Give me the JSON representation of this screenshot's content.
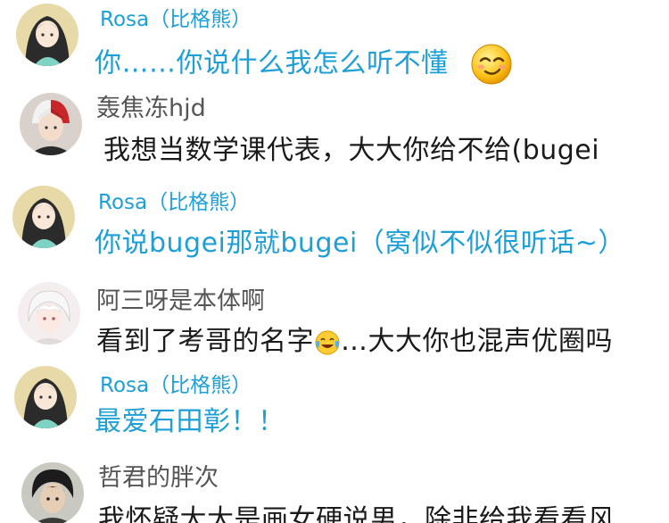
{
  "comments": [
    {
      "username": "Rosa（比格熊）",
      "avatar": "anime-girl-avatar",
      "is_host": true,
      "message": "你……你说什么我怎么听不懂",
      "trailing_emoji": "smirk-face-emoji"
    },
    {
      "username": "轰焦冻hjd",
      "avatar": "anime-boy-red-white-hair-avatar",
      "is_host": false,
      "message": "我想当数学课代表，大大你给不给(bugei"
    },
    {
      "username": "Rosa（比格熊）",
      "avatar": "anime-girl-avatar",
      "is_host": true,
      "message": "你说bugei那就bugei（窝似不似很听话~）"
    },
    {
      "username": "阿三呀是本体啊",
      "avatar": "anime-white-hair-avatar",
      "is_host": false,
      "message_before": "看到了考哥的名字",
      "inline_emoji": "laughing-tears-emoji",
      "message_after": "…大大你也混声优圈吗"
    },
    {
      "username": "Rosa（比格熊）",
      "avatar": "anime-girl-avatar",
      "is_host": true,
      "message": "最爱石田彰！！"
    },
    {
      "username": "哲君的胖次",
      "avatar": "dark-hair-boy-avatar",
      "is_host": false,
      "message": "我怀疑大大是画女硬说男，除非给我看看风"
    }
  ],
  "colors": {
    "host_text": "#1e9fd6",
    "guest_name": "#555555",
    "guest_text": "#1a1a1a",
    "background": "#ffffff"
  }
}
